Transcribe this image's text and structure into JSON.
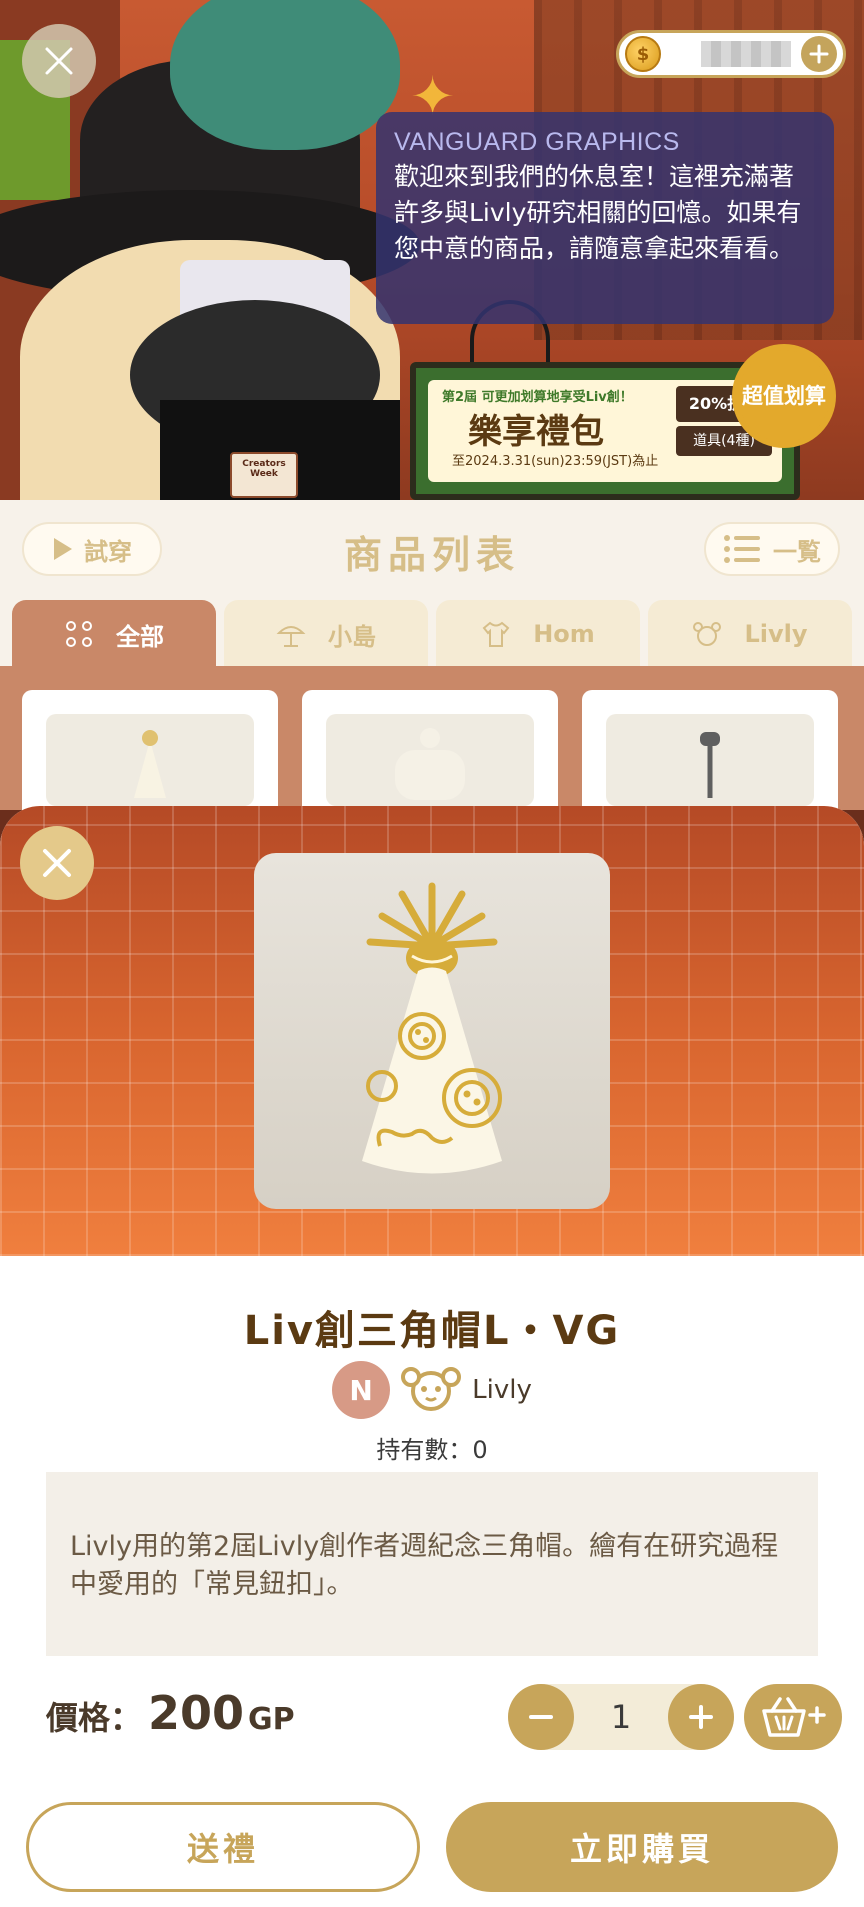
{
  "scene": {
    "badge_text": "Creators Week",
    "currency": {
      "icon": "coin-icon",
      "amount_hidden": true
    },
    "dialog": {
      "speaker": "VANGUARD GRAPHICS",
      "message": "歡迎來到我們的休息室！這裡充滿著許多與Livly研究相關的回憶。如果有您中意的商品，請隨意拿起來看看。"
    },
    "banner": {
      "tag": "第2屆 可更加划算地享受Liv創！",
      "title": "樂享禮包",
      "date": "至2024.3.31(sun)23:59(JST)為止",
      "discount": "20%折扣",
      "items": "道具(4種)",
      "burst": "超值划算"
    }
  },
  "shop": {
    "try_on": "試穿",
    "title": "商品列表",
    "list_view": "一覧",
    "tabs": [
      {
        "label": "全部",
        "icon": "dots-grid-icon",
        "active": true
      },
      {
        "label": "小島",
        "icon": "island-icon",
        "active": false
      },
      {
        "label": "Hom",
        "icon": "shirt-icon",
        "active": false
      },
      {
        "label": "Livly",
        "icon": "livly-icon",
        "active": false
      }
    ]
  },
  "item": {
    "name": "Liv創三角帽L・VG",
    "rank": "N",
    "category": "Livly",
    "owned": "持有數：0",
    "description": "Livly用的第2屆Livly創作者週紀念三角帽。繪有在研究過程中愛用的「常見鈕扣」。",
    "price_label": "價格：",
    "price_value": "200",
    "price_unit": "GP",
    "quantity": "1"
  },
  "actions": {
    "gift": "送禮",
    "buy": "立即購買"
  },
  "colors": {
    "gold": "#c7a55a",
    "brown_text": "#5b3a12",
    "modal_gradient_top": "#b54a26",
    "modal_gradient_bottom": "#f07f3e",
    "rank_badge": "#d79a86"
  }
}
